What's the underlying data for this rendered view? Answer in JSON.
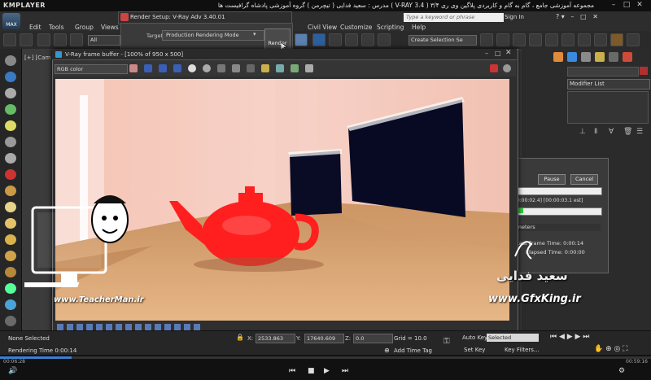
{
  "player": {
    "logo": "KMPLAYER",
    "title": "مجموعه آموزشی جامع ، گام به گام و کاربردی پلاگین وی ری ۳/۴ ( V-RAY 3.4 ) مدرس : سعید فدایی ( تیچرمن ) گروه آموزشی پادشاه گرافیست ها",
    "time_elapsed": "00:06:28",
    "time_total": "00:59:16"
  },
  "menubar": {
    "items": [
      "Edit",
      "Tools",
      "Group",
      "Views",
      "Civil View",
      "Customize",
      "Scripting",
      "Help"
    ],
    "search_placeholder": "Type a keyword or phrase",
    "signin": "Sign In"
  },
  "toolbar": {
    "filter": "All",
    "selection_set": "Create Selection Se"
  },
  "viewport": {
    "label": "[+] [Cam"
  },
  "render_setup": {
    "title": "Render Setup: V-Ray Adv 3.40.01",
    "target_label": "Target:",
    "target_value": "Production Rendering Mode",
    "render_button": "Render"
  },
  "vfb": {
    "title": "V-Ray frame buffer - [100% of 950 x 500]",
    "channel": "RGB color"
  },
  "progress": {
    "pause": "Pause",
    "cancel": "Cancel",
    "time": "00:00:02.4] [00:00:03.1 est]",
    "pass2_fraction": 0.09,
    "params_header": "rameters",
    "last_frame": "Last Frame Time:  0:00:14",
    "elapsed": "Elapsed Time:  0:00:00"
  },
  "command_panel": {
    "modifier_list": "Modifier List"
  },
  "status": {
    "selection": "None Selected",
    "render_time": "Rendering Time  0:00:14",
    "x_label": "X:",
    "x_value": "2533.863",
    "y_label": "Y:",
    "y_value": "17640.609",
    "z_label": "Z:",
    "z_value": "0.0",
    "grid": "Grid = 10.0",
    "add_time_tag": "Add Time Tag",
    "auto_key": "Auto Key",
    "selected": "Selected",
    "set_key": "Set Key",
    "key_filters": "Key Filters..."
  },
  "watermarks": {
    "teacherman_url": "www.TeacherMan.ir",
    "teacherman_logo_text": "Teacher Man",
    "gfxking_url": "www.GfxKing.ir",
    "gfxking_name": "سعید فدایی"
  }
}
